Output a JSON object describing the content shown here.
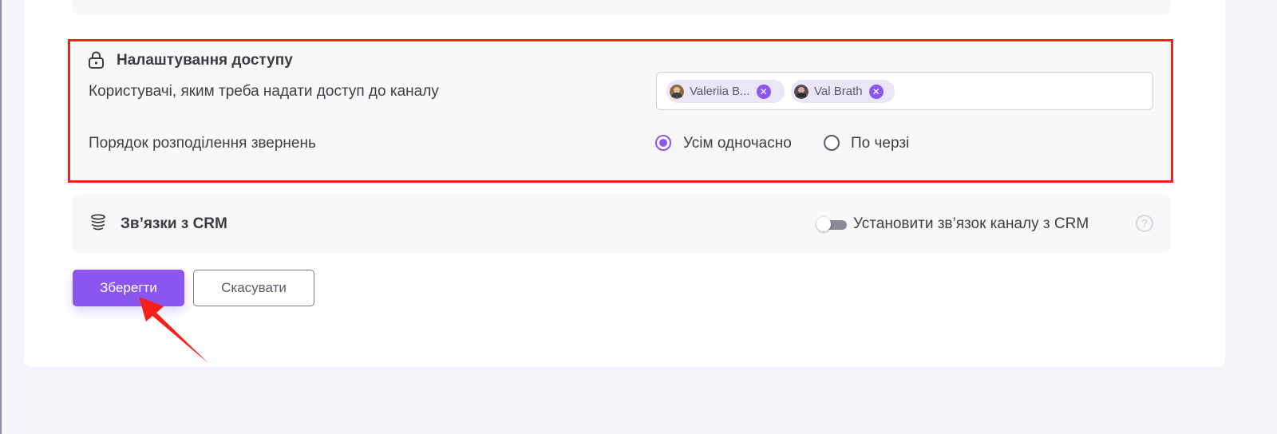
{
  "access": {
    "title": "Налаштування доступу",
    "icon": "lock-icon",
    "users_label": "Користувачі, яким треба надати доступ до каналу",
    "users": [
      {
        "name": "Valeriia B...",
        "remove": "✕"
      },
      {
        "name": "Val Brath",
        "remove": "✕"
      }
    ],
    "distribution_label": "Порядок розподілення звернень",
    "distribution_options": [
      {
        "label": "Усім одночасно",
        "selected": true
      },
      {
        "label": "По черзі",
        "selected": false
      }
    ]
  },
  "crm": {
    "title": "Зв’язки з CRM",
    "icon": "database-stack-icon",
    "toggle_label": "Установити зв’язок каналу з CRM",
    "toggle_on": false,
    "help": "?"
  },
  "actions": {
    "save_label": "Зберегти",
    "cancel_label": "Скасувати"
  },
  "colors": {
    "accent": "#8b56f0",
    "highlight": "#f5201a",
    "annotation_arrow": "#f5201a"
  }
}
